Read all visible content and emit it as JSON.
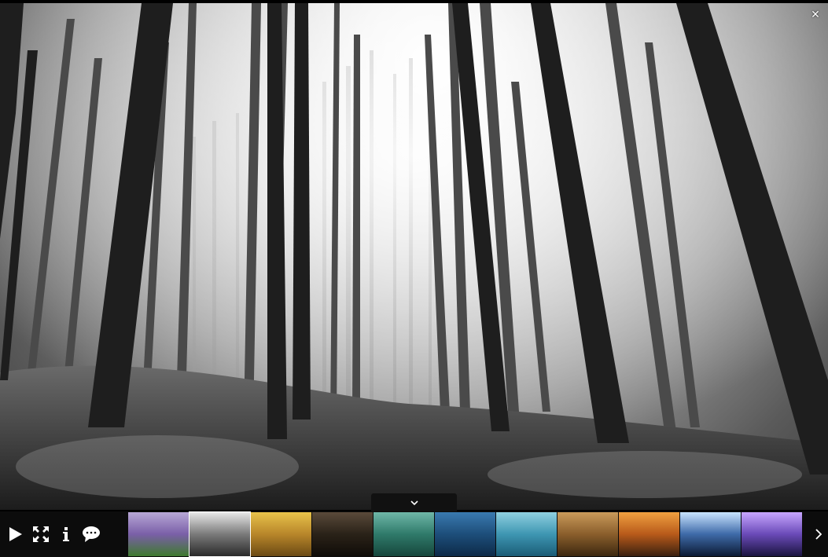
{
  "viewer": {
    "main_image": "misty-black-and-white-forest",
    "close_icon": "close-icon",
    "toggle_icon": "chevron-down-icon",
    "next_icon": "chevron-right-icon"
  },
  "controls": [
    {
      "name": "play-button",
      "icon": "play-icon"
    },
    {
      "name": "fullscreen-button",
      "icon": "fullscreen-icon"
    },
    {
      "name": "info-button",
      "icon": "info-icon"
    },
    {
      "name": "comments-button",
      "icon": "speech-bubble-icon"
    }
  ],
  "thumbnails": [
    {
      "name": "thumb-lavender-field",
      "colors": [
        "#b7a7d6",
        "#7a5fa8",
        "#3e7a2e"
      ]
    },
    {
      "name": "thumb-forest",
      "colors": [
        "#e8e8e8",
        "#7a7a7a",
        "#2a2a2a"
      ]
    },
    {
      "name": "thumb-golden-trees",
      "colors": [
        "#e8c24a",
        "#b8862a",
        "#6b4a14"
      ]
    },
    {
      "name": "thumb-elephant",
      "colors": [
        "#5a4a3a",
        "#2a2218",
        "#0f0c08"
      ]
    },
    {
      "name": "thumb-manatee",
      "colors": [
        "#6fb7a8",
        "#2f7a6a",
        "#16463c"
      ]
    },
    {
      "name": "thumb-whale",
      "colors": [
        "#3a7ab0",
        "#1d4e7a",
        "#0d2a48"
      ]
    },
    {
      "name": "thumb-seal",
      "colors": [
        "#8fd0e0",
        "#3e96b2",
        "#1a5c76"
      ]
    },
    {
      "name": "thumb-lion",
      "colors": [
        "#c99a5a",
        "#8a5e2c",
        "#3c2810"
      ]
    },
    {
      "name": "thumb-city-sunset",
      "colors": [
        "#f0a040",
        "#b85a1a",
        "#3a2010"
      ]
    },
    {
      "name": "thumb-light-trails",
      "colors": [
        "#c9e4ff",
        "#3e6aa8",
        "#0c1a34"
      ]
    },
    {
      "name": "thumb-purple-lake",
      "colors": [
        "#c7a6ff",
        "#6a4ab8",
        "#1a1440"
      ]
    }
  ]
}
